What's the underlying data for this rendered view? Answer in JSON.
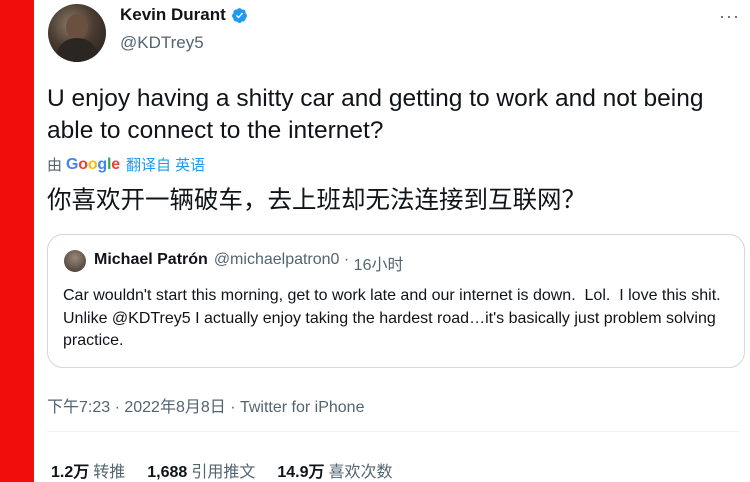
{
  "author": {
    "name": "Kevin Durant",
    "handle": "@KDTrey5"
  },
  "more_label": "···",
  "tweet_text": "U enjoy having a shitty car and getting to work and not being able to connect to the internet?",
  "translation": {
    "prefix": "由",
    "provider": "Google",
    "label": "翻译自 英语",
    "text": "你喜欢开一辆破车，去上班却无法连接到互联网？"
  },
  "quoted_tweet": {
    "name": "Michael Patrón",
    "handle": "@michaelpatron0",
    "separator": " · ",
    "time": "16小时",
    "text": "Car wouldn't start this morning, get to work late and our internet is down.  Lol.  I love this shit.  Unlike @KDTrey5 I actually enjoy taking the hardest road…it's basically just problem solving practice."
  },
  "meta": "下午7:23 · 2022年8月8日 · Twitter for iPhone",
  "stats": {
    "retweets_count": "1.2万",
    "retweets_label": "转推",
    "quotes_count": "1,688",
    "quotes_label": "引用推文",
    "likes_count": "14.9万",
    "likes_label": "喜欢次数"
  },
  "colors": {
    "side_bar": "#f20d0d",
    "verified": "#1d9bf0",
    "secondary_text": "#536471"
  }
}
